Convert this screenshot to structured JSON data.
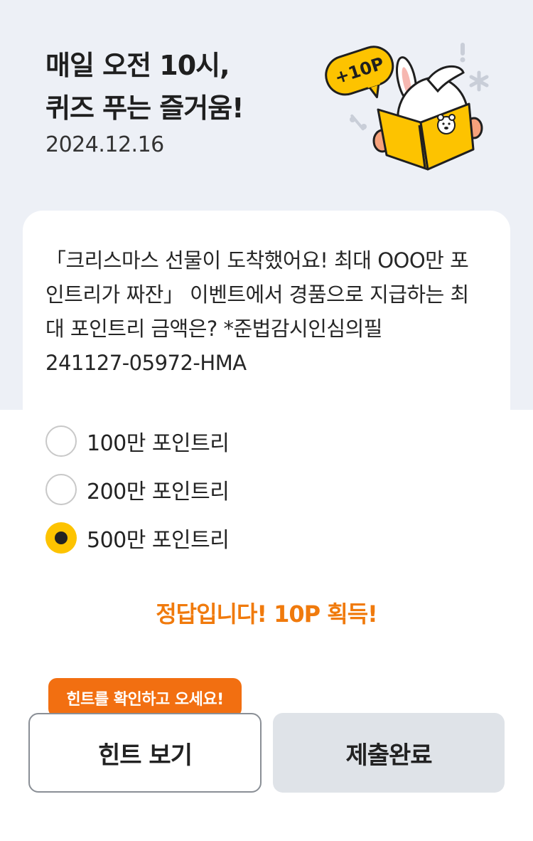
{
  "header": {
    "title_line1": "매일 오전 10시,",
    "title_line2": "퀴즈 푸는 즐거움!",
    "date": "2024.12.16",
    "badge": "+10P"
  },
  "question": {
    "lines": [
      "「크리스마스 선물이 도착했어요! 최대 OOO만 포",
      "인트리가 짜잔」 이벤트에서 경품으로 지급하는 최",
      "대 포인트리 금액은? *준법감시인심의필",
      "241127-05972-HMA"
    ]
  },
  "options": [
    {
      "label": "100만 포인트리",
      "selected": false
    },
    {
      "label": "200만 포인트리",
      "selected": false
    },
    {
      "label": "500만 포인트리",
      "selected": true
    }
  ],
  "result_message": "정답입니다! 10P 획득!",
  "tooltip": "힌트를 확인하고 오세요!",
  "buttons": {
    "hint": "힌트 보기",
    "submit": "제출완료"
  },
  "colors": {
    "header_bg": "#edf0f6",
    "accent_yellow": "#fdc300",
    "accent_orange": "#f26f11",
    "result_text": "#f07a0c",
    "submit_bg": "#dfe3e8"
  }
}
